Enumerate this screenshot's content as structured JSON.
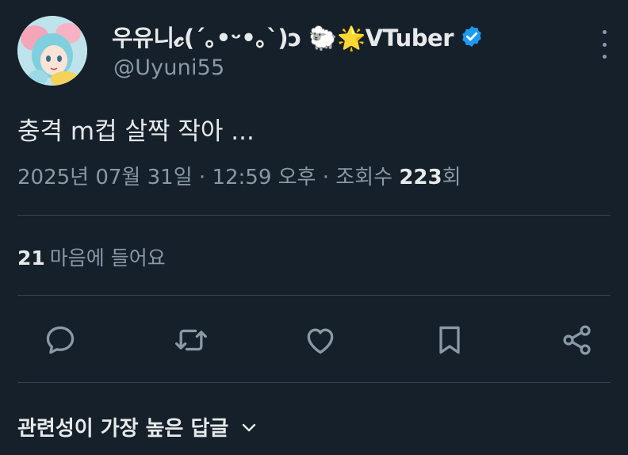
{
  "author": {
    "display_name": "우유니𝓬(´｡•ᵕ•｡`)ɔ 🐑🌟VTuber",
    "handle": "@Uyuni55",
    "verified": true
  },
  "tweet": {
    "text": "충격 m컵 살짝 작아 ...",
    "date": "2025년 07월 31일",
    "separator": "·",
    "time": "12:59 오후",
    "views_label": "조회수",
    "views_count": "223",
    "views_suffix": "회"
  },
  "likes": {
    "count": "21",
    "label": "마음에 들어요"
  },
  "actions": {
    "reply": "reply-icon",
    "retweet": "retweet-icon",
    "like": "heart-icon",
    "bookmark": "bookmark-icon",
    "share": "share-icon"
  },
  "replies_sort": {
    "label": "관련성이 가장 높은 답글"
  },
  "colors": {
    "background": "#15202b",
    "text_primary": "#e7e9ea",
    "text_secondary": "#8b98a5",
    "divider": "#38444d",
    "verified": "#1d9bf0"
  }
}
